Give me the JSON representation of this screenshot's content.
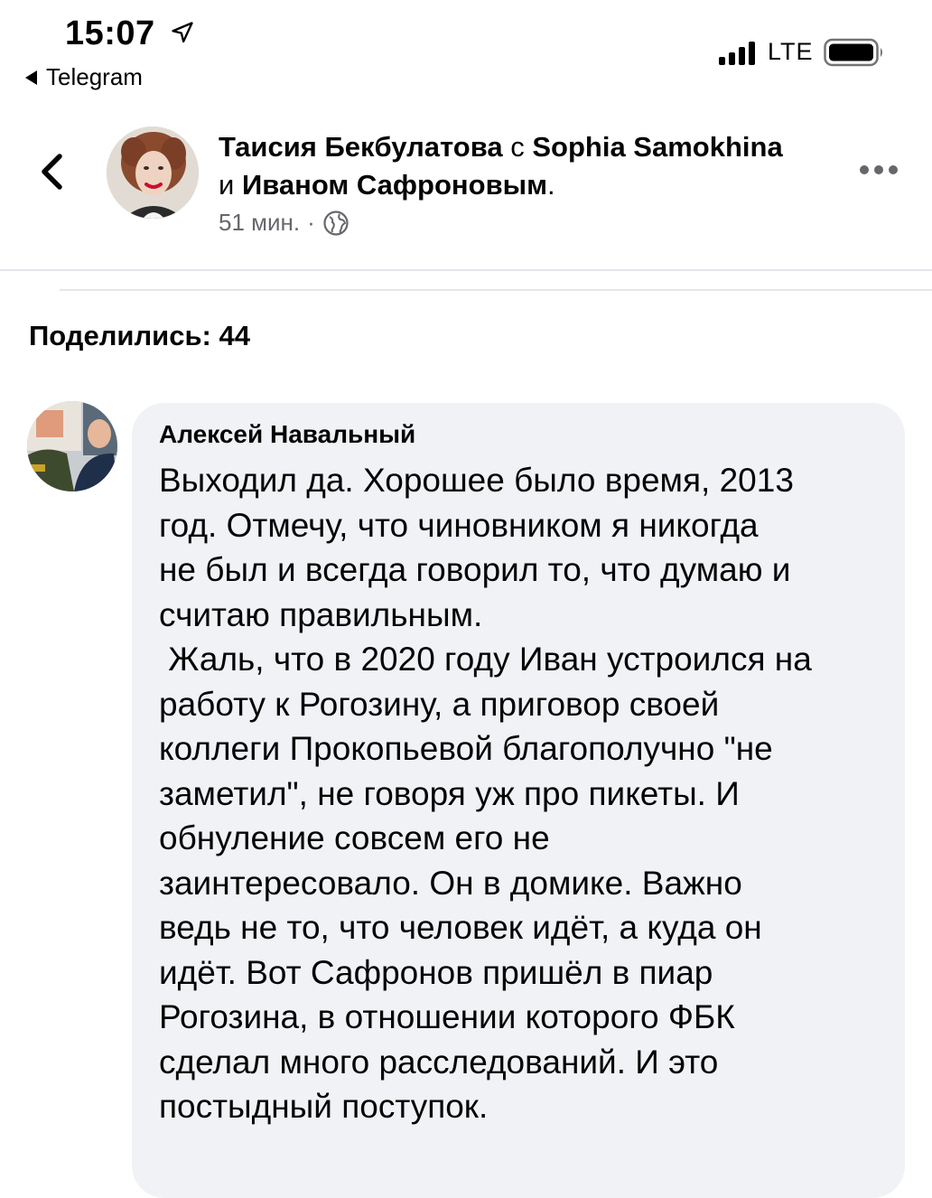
{
  "status_bar": {
    "time": "15:07",
    "back_app": "Telegram",
    "network": "LTE"
  },
  "post": {
    "author": "Таисия Бекбулатова",
    "with_word": "с",
    "tagged_1": "Sophia Samokhina",
    "and_word": "и",
    "tagged_2": "Иваном Сафроновым",
    "time_ago": "51 мин.",
    "separator": "·",
    "privacy_icon": "globe-icon",
    "more_icon": "more-dots-icon"
  },
  "shares": {
    "label": "Поделились: 44"
  },
  "comment": {
    "author": "Алексей Навальный",
    "text": "Выходил да. Хорошее было время, 2013\nгод. Отмечу, что чиновником я никогда\nне был и всегда говорил то, что думаю и\nсчитаю правильным.\n Жаль, что в 2020 году Иван устроился на\nработу к Рогозину, а приговор своей\nколлеги Прокопьевой благополучно \"не\nзаметил\", не говоря уж про пикеты. И\nобнуление совсем его не\nзаинтересовало. Он в домике. Важно\nведь не то, что человек идёт, а куда он\nидёт. Вот Сафронов пришёл в пиар\nРогозина, в отношении которого ФБК\nсделал много расследований. И это\nпостыдный поступок."
  },
  "colors": {
    "text": "#050505",
    "secondary_text": "#65676b",
    "bubble": "#f0f2f5",
    "divider": "#e4e6eb"
  }
}
